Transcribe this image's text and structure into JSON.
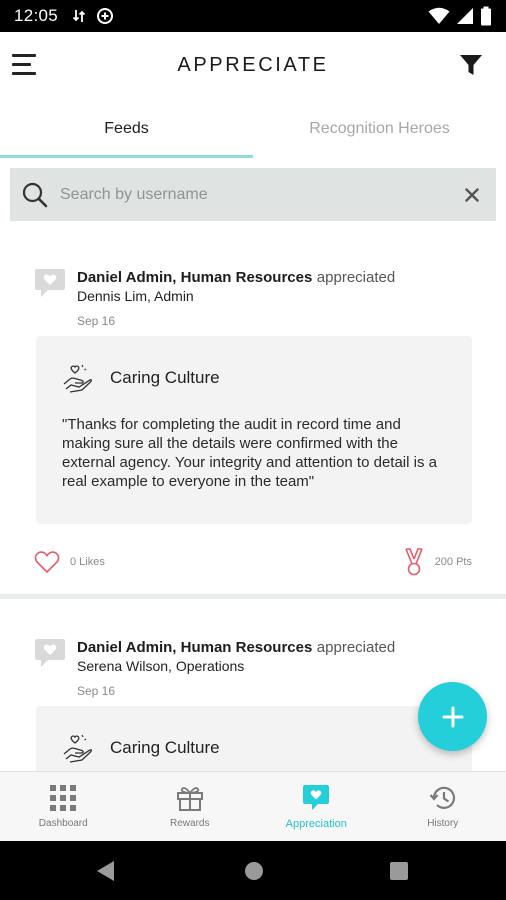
{
  "status_bar": {
    "time": "12:05"
  },
  "app_bar": {
    "title": "APPRECIATE"
  },
  "tabs": [
    {
      "label": "Feeds",
      "active": true
    },
    {
      "label": "Recognition Heroes",
      "active": false
    }
  ],
  "search": {
    "placeholder": "Search by username",
    "value": ""
  },
  "feed": [
    {
      "sender": "Daniel Admin, Human Resources",
      "verb": "appreciated",
      "recipient": "Dennis Lim, Admin",
      "date": "Sep 16",
      "value_name": "Caring Culture",
      "message": "\"Thanks for completing the audit in record time and making sure all the details were confirmed with the external agency. Your integrity and attention to detail is a real example to everyone in the team\"",
      "likes_label": "0 Likes",
      "points_label": "200 Pts"
    },
    {
      "sender": "Daniel Admin, Human Resources",
      "verb": "appreciated",
      "recipient": "Serena Wilson, Operations",
      "date": "Sep 16",
      "value_name": "Caring Culture"
    }
  ],
  "bottom_nav": [
    {
      "label": "Dashboard",
      "icon": "grid-icon",
      "active": false
    },
    {
      "label": "Rewards",
      "icon": "gift-icon",
      "active": false
    },
    {
      "label": "Appreciation",
      "icon": "heart-bubble-icon",
      "active": true
    },
    {
      "label": "History",
      "icon": "history-icon",
      "active": false
    }
  ],
  "colors": {
    "accent": "#25cfd9",
    "tab_underline": "#8fdbe0",
    "heart": "#e45b6b",
    "search_bg": "#dfe3e2"
  }
}
